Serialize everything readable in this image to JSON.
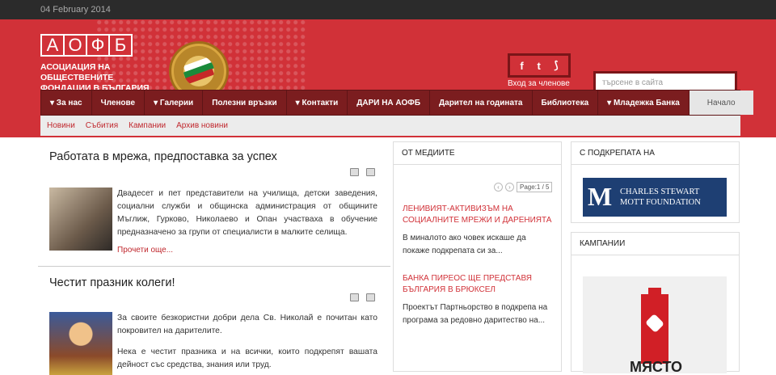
{
  "topbar": {
    "date": "04 February 2014"
  },
  "logo": {
    "letters": [
      "А",
      "О",
      "Ф",
      "Б"
    ],
    "line1": "АСОЦИАЦИЯ НА ОБЩЕСТВЕНИТЕ",
    "line2": "ФОНДАЦИИ В БЪЛГАРИЯ"
  },
  "social": {
    "facebook": "f",
    "twitter": "t",
    "rss": "⟆"
  },
  "members_link": "Вход за членове",
  "search": {
    "placeholder": "търсене в сайта"
  },
  "nav": {
    "items": [
      {
        "label": "▾ За нас"
      },
      {
        "label": "Членове"
      },
      {
        "label": "▾ Галерии"
      },
      {
        "label": "Полезни връзки"
      },
      {
        "label": "▾ Контакти"
      },
      {
        "label": "ДАРИ НА АОФБ"
      },
      {
        "label": "Дарител на годината"
      },
      {
        "label": "Библиотека"
      },
      {
        "label": "▾ Младежка Банка"
      }
    ],
    "active": "Начало"
  },
  "subnav": [
    "Новини",
    "Събития",
    "Кампании",
    "Архив новини"
  ],
  "posts": [
    {
      "title": "Работата в мрежа, предпоставка за успех",
      "text": "Двадесет и пет представители на училища, детски заведения, социални служби и общинска администрация от общините Мъглиж, Гурково, Николаево и Опан участваха в обучение предназначено за групи от специалисти в малките селища.",
      "more": "Прочети още..."
    },
    {
      "title": "Честит празник колеги!",
      "text1": "За своите безкористни добри дела Св. Николай е почитан като покровител на дарителите.",
      "text2": "Нека е честит празника и на всички, които подкрепят вашата дейност със средства, знания или труд."
    }
  ],
  "media": {
    "title": "ОТ МЕДИИТЕ",
    "page": "Page:1 / 5",
    "items": [
      {
        "headline": "ЛЕНИВИЯТ-АКТИВИЗЪМ НА СОЦИАЛНИТЕ МРЕЖИ И ДАРЕНИЯТА",
        "text": "В миналото ако човек искаше да покаже подкрепата си за..."
      },
      {
        "headline": "БАНКА ПИРЕОС ЩЕ ПРЕДСТАВЯ БЪЛГАРИЯ В БРЮКСЕЛ",
        "text": "Проектът Партньорство в подкрепа на програма за редовно даритество на..."
      }
    ]
  },
  "support": {
    "title": "С ПОДКРЕПАТА НА",
    "mott_mark": "M",
    "mott_line1": "CHARLES STEWART",
    "mott_line2": "MOTT FOUNDATION"
  },
  "campaigns": {
    "title": "КАМПАНИИ",
    "banner_text": "МЯСТО"
  }
}
